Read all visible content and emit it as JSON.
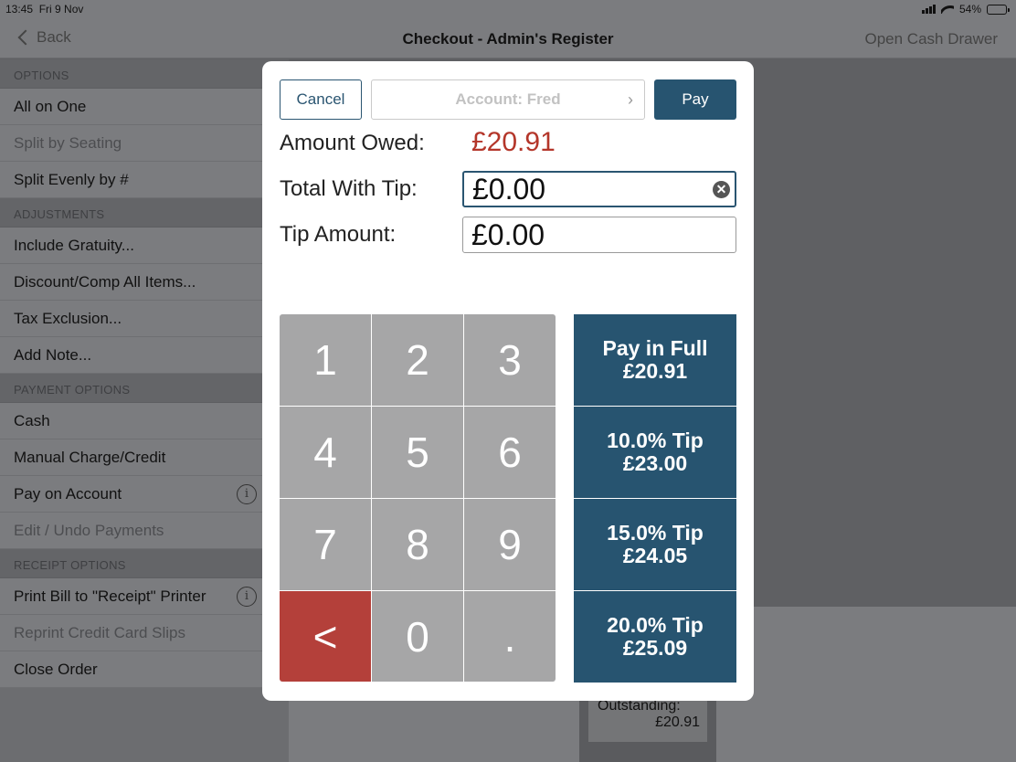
{
  "status": {
    "time": "13:45",
    "date": "Fri 9 Nov",
    "battery": "54%",
    "battery_level": 0.54
  },
  "navbar": {
    "back_label": "Back",
    "title": "Checkout - Admin's Register",
    "right_action": "Open Cash Drawer"
  },
  "sidebar": {
    "sections": [
      {
        "header": "OPTIONS",
        "items": [
          {
            "label": "All on One",
            "enabled": true,
            "info": false
          },
          {
            "label": "Split by Seating",
            "enabled": false,
            "info": false
          },
          {
            "label": "Split Evenly by #",
            "enabled": true,
            "info": false
          }
        ]
      },
      {
        "header": "ADJUSTMENTS",
        "items": [
          {
            "label": "Include Gratuity...",
            "enabled": true,
            "info": false
          },
          {
            "label": "Discount/Comp All Items...",
            "enabled": true,
            "info": false
          },
          {
            "label": "Tax Exclusion...",
            "enabled": true,
            "info": false
          },
          {
            "label": "Add Note...",
            "enabled": true,
            "info": false
          }
        ]
      },
      {
        "header": "PAYMENT OPTIONS",
        "items": [
          {
            "label": "Cash",
            "enabled": true,
            "info": false
          },
          {
            "label": "Manual Charge/Credit",
            "enabled": true,
            "info": false
          },
          {
            "label": "Pay on Account",
            "enabled": true,
            "info": true
          },
          {
            "label": "Edit / Undo Payments",
            "enabled": false,
            "info": false
          }
        ]
      },
      {
        "header": "RECEIPT OPTIONS",
        "items": [
          {
            "label": "Print Bill to \"Receipt\" Printer",
            "enabled": true,
            "info": true
          },
          {
            "label": "Reprint Credit Card Slips",
            "enabled": false,
            "info": false
          },
          {
            "label": "Close Order",
            "enabled": true,
            "info": false
          }
        ]
      }
    ]
  },
  "outstanding": {
    "label": "Outstanding:",
    "amount": "£20.91"
  },
  "modal": {
    "cancel_label": "Cancel",
    "account_label": "Account: Fred",
    "account_arrow": "›",
    "pay_label": "Pay",
    "amount_owed_label": "Amount Owed:",
    "amount_owed_value": "£20.91",
    "total_with_tip_label": "Total With Tip:",
    "total_with_tip_value": "£0.00",
    "tip_amount_label": "Tip Amount:",
    "tip_amount_value": "£0.00",
    "clear_glyph": "✕",
    "keypad": [
      "1",
      "2",
      "3",
      "4",
      "5",
      "6",
      "7",
      "8",
      "9",
      "<",
      "0",
      "."
    ],
    "quick_buttons": [
      {
        "title": "Pay in Full",
        "amount": "£20.91"
      },
      {
        "title": "10.0% Tip",
        "amount": "£23.00"
      },
      {
        "title": "15.0% Tip",
        "amount": "£24.05"
      },
      {
        "title": "20.0% Tip",
        "amount": "£25.09"
      }
    ]
  },
  "colors": {
    "accent": "#275470",
    "danger": "#b4403a",
    "owed": "#b4362a",
    "key": "#a6a6a7"
  }
}
